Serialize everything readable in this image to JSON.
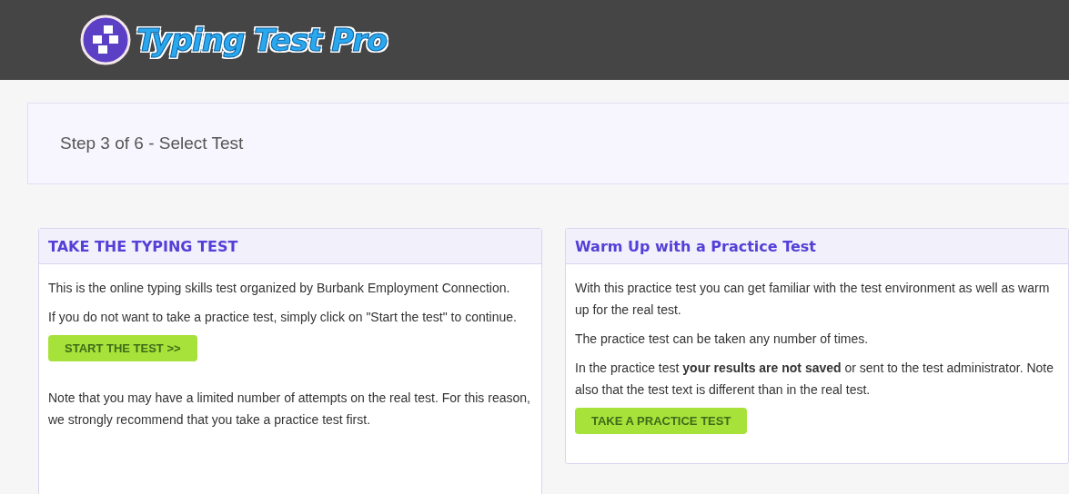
{
  "header": {
    "logo_text": "Typing Test Pro"
  },
  "step": {
    "title": "Step 3 of 6 - Select Test"
  },
  "cards": [
    {
      "title": "TAKE THE TYPING TEST",
      "blocks": [
        {
          "kind": "paragraph",
          "text": "This is the online typing skills test organized by Burbank Employment Connection."
        },
        {
          "kind": "paragraph",
          "text": "If you do not want to take a practice test, simply click on \"Start the test\" to continue."
        },
        {
          "kind": "button",
          "text": "START THE TEST >>"
        },
        {
          "kind": "paragraph",
          "text": "Note that you may have a limited number of attempts on the real test. For this reason, we strongly recommend that you take a practice test first."
        }
      ]
    },
    {
      "title": "Warm Up with a Practice Test",
      "blocks": [
        {
          "kind": "paragraph",
          "text": "With this practice test you can get familiar with the test environment as well as warm up for the real test."
        },
        {
          "kind": "paragraph",
          "text": "The practice test can be taken any number of times."
        },
        {
          "kind": "paragraph",
          "text": "In the practice test **your results are not saved** or sent to the test administrator. Note also that the test text is different than in the real test."
        },
        {
          "kind": "button",
          "text": "TAKE A PRACTICE TEST"
        }
      ]
    }
  ]
}
